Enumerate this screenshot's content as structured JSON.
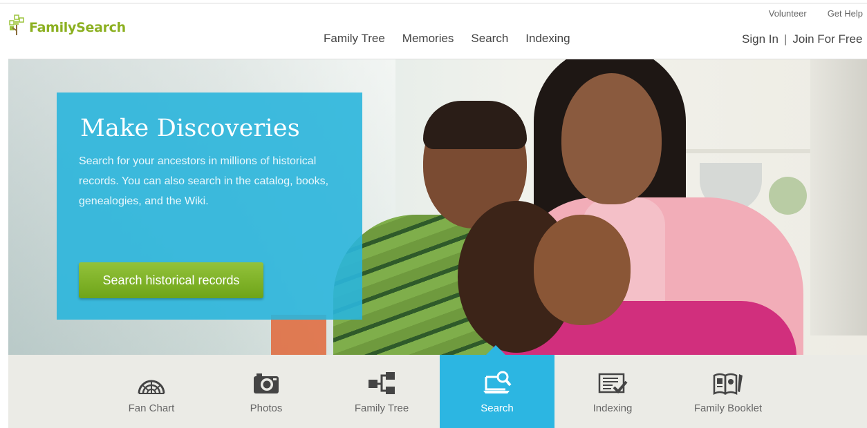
{
  "header": {
    "logo_text": "FamilySearch",
    "util_links": [
      "Volunteer",
      "Get Help"
    ],
    "nav": [
      "Family Tree",
      "Memories",
      "Search",
      "Indexing"
    ],
    "sign_in": "Sign In",
    "separator": "|",
    "join": "Join For Free"
  },
  "hero": {
    "title": "Make Discoveries",
    "description": "Search for your ancestors in millions of historical records. You can also search in the catalog, books, genealogies, and the Wiki.",
    "button_label": "Search historical records"
  },
  "features": [
    {
      "label": "Fan Chart",
      "icon": "fan-chart-icon"
    },
    {
      "label": "Photos",
      "icon": "camera-icon"
    },
    {
      "label": "Family Tree",
      "icon": "tree-diagram-icon"
    },
    {
      "label": "Search",
      "icon": "search-computer-icon",
      "active": true
    },
    {
      "label": "Indexing",
      "icon": "indexing-icon"
    },
    {
      "label": "Family Booklet",
      "icon": "booklet-icon"
    }
  ],
  "colors": {
    "brand_green": "#8cb021",
    "panel_blue": "#2ab5db",
    "active_blue": "#2cb6e2",
    "button_green": "#7cb026"
  }
}
